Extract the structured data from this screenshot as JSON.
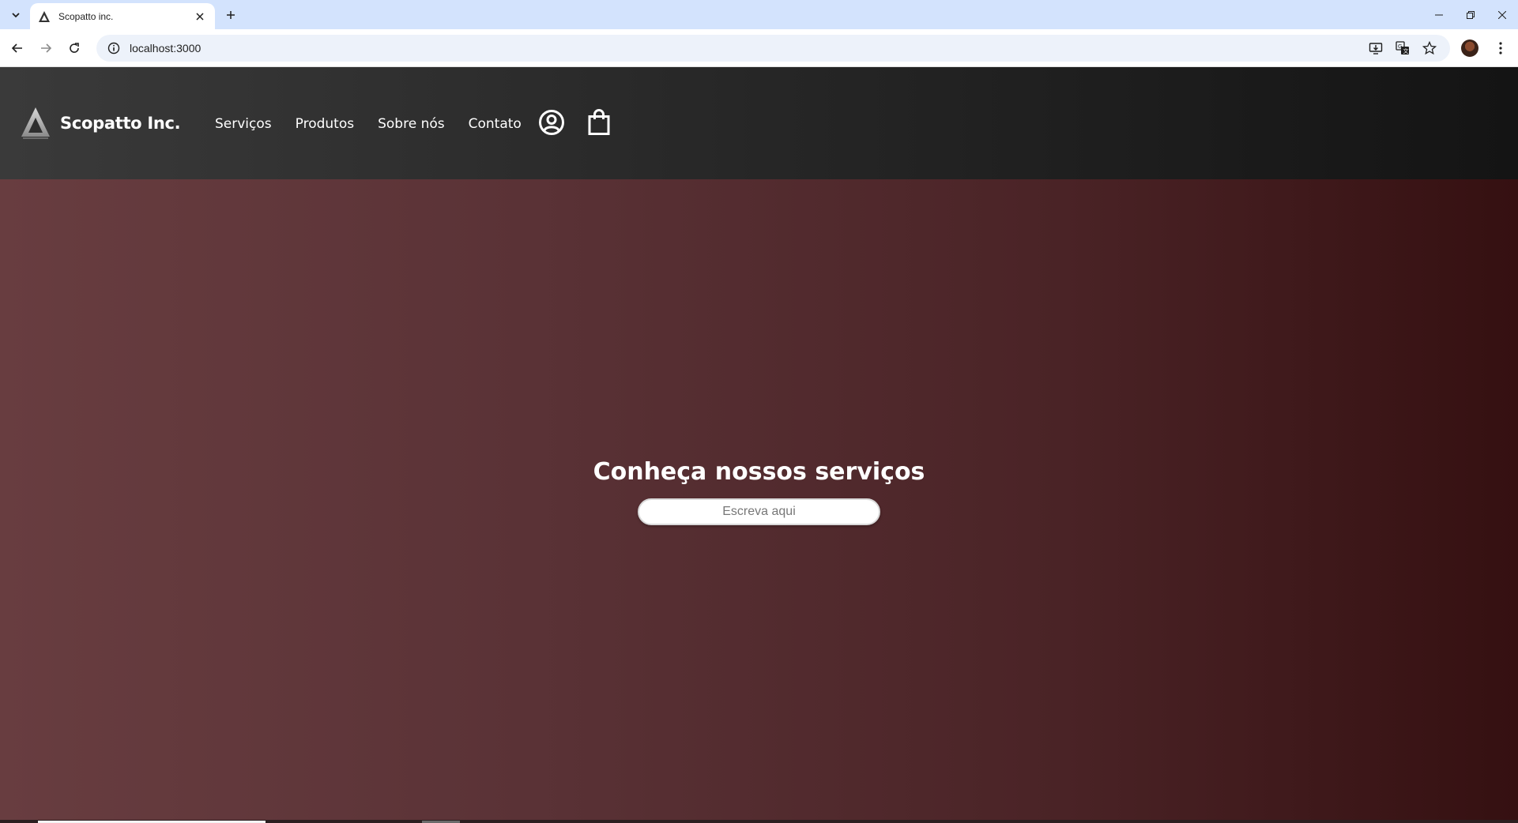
{
  "browser": {
    "tab_title": "Scopatto inc.",
    "url": "localhost:3000"
  },
  "site": {
    "brand_name": "Scopatto Inc.",
    "nav": [
      "Serviços",
      "Produtos",
      "Sobre nós",
      "Contato"
    ]
  },
  "hero": {
    "title": "Conheça nossos serviços",
    "search_placeholder": "Escreva aqui"
  },
  "colors": {
    "header_gradient": [
      "#3a3a3a",
      "#141414"
    ],
    "hero_gradient": [
      "#683d40",
      "#351011"
    ],
    "tabstrip": "#d3e3fd"
  }
}
